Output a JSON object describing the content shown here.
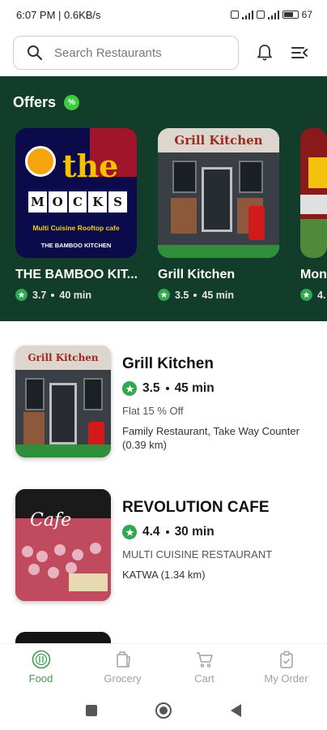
{
  "status_bar": {
    "time_speed": "6:07 PM | 0.6KB/s",
    "battery": "67"
  },
  "search": {
    "placeholder": "Search Restaurants"
  },
  "offers": {
    "title": "Offers",
    "badge": "%",
    "cards": [
      {
        "name": "THE BAMBOO KIT...",
        "rating": "3.7",
        "time": "40 min",
        "art": {
          "the": "the",
          "mocks": [
            "M",
            "O",
            "C",
            "K",
            "S"
          ],
          "subtitle": "Multi Cuisine Rooftop cafe",
          "powered": "THE BAMBOO KITCHEN"
        }
      },
      {
        "name": "Grill Kitchen",
        "rating": "3.5",
        "time": "45 min",
        "sign": "Grill Kitchen"
      },
      {
        "name": "Mon",
        "rating": "4.",
        "time": ""
      }
    ]
  },
  "restaurants": [
    {
      "name": "Grill Kitchen",
      "rating": "3.5",
      "time": "45 min",
      "offer": "Flat 15 % Off",
      "detail": "Family Restaurant, Take Way Counter (0.39 km)",
      "sign": "Grill Kitchen"
    },
    {
      "name": "REVOLUTION CAFE",
      "rating": "4.4",
      "time": "30 min",
      "type": "MULTI CUISINE RESTAURANT",
      "detail": "KATWA (1.34 km)",
      "logo": "Cafe"
    }
  ],
  "bottom_nav": [
    {
      "label": "Food",
      "icon": "food-icon",
      "active": true
    },
    {
      "label": "Grocery",
      "icon": "grocery-icon",
      "active": false
    },
    {
      "label": "Cart",
      "icon": "cart-icon",
      "active": false
    },
    {
      "label": "My Order",
      "icon": "order-icon",
      "active": false
    }
  ],
  "colors": {
    "accent": "#3f9d4c",
    "offers_bg": "#123d2b",
    "rating_green": "#2fa84f"
  }
}
